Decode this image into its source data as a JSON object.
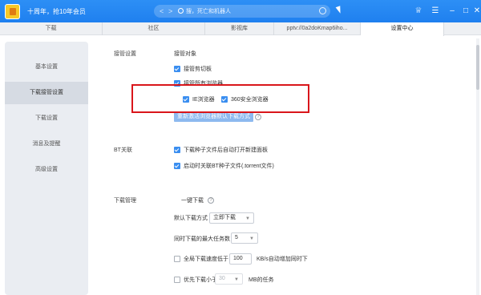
{
  "titlebar": {
    "promo": "十周年，抢10年会员",
    "search_placeholder": "搜，死亡和机器人",
    "nav_back": "<",
    "nav_forward": ">"
  },
  "tabs": [
    {
      "label": "下载"
    },
    {
      "label": "社区"
    },
    {
      "label": "影视库"
    },
    {
      "label": "pptv://0a2doKmap6iho..."
    },
    {
      "label": "设置中心"
    }
  ],
  "sidebar": {
    "items": [
      {
        "label": "基本设置"
      },
      {
        "label": "下载接管设置"
      },
      {
        "label": "下载设置"
      },
      {
        "label": "消息及提醒"
      },
      {
        "label": "高级设置"
      }
    ]
  },
  "takeover": {
    "section": "接管设置",
    "target_header": "接管对象",
    "clipboard": "接管剪切板",
    "browsers": "接管所有浏览器",
    "ie": "IE浏览器",
    "browser360": "360安全浏览器",
    "repair_button": "重新激活浏览器默认下载方式"
  },
  "bt": {
    "section": "BT关联",
    "open_panel": "下载种子文件后自动打开新建面板",
    "associate": "启动时关联BT种子文件(.torrent文件)"
  },
  "download_mgmt": {
    "section": "下载管理",
    "one_click": "一键下载",
    "default_mode_label": "默认下载方式",
    "default_mode_value": "立即下载",
    "max_tasks_label": "同时下载的最大任务数",
    "max_tasks_value": "5",
    "global_speed_label": "全局下载速度低于",
    "global_speed_value": "100",
    "global_speed_suffix": "KB/s自动增加同时下",
    "priority_label": "优先下载小于",
    "priority_value": "30",
    "priority_suffix": "MB的任务"
  },
  "colors": {
    "accent": "#1f80ef",
    "highlight_box": "#d9161b"
  }
}
